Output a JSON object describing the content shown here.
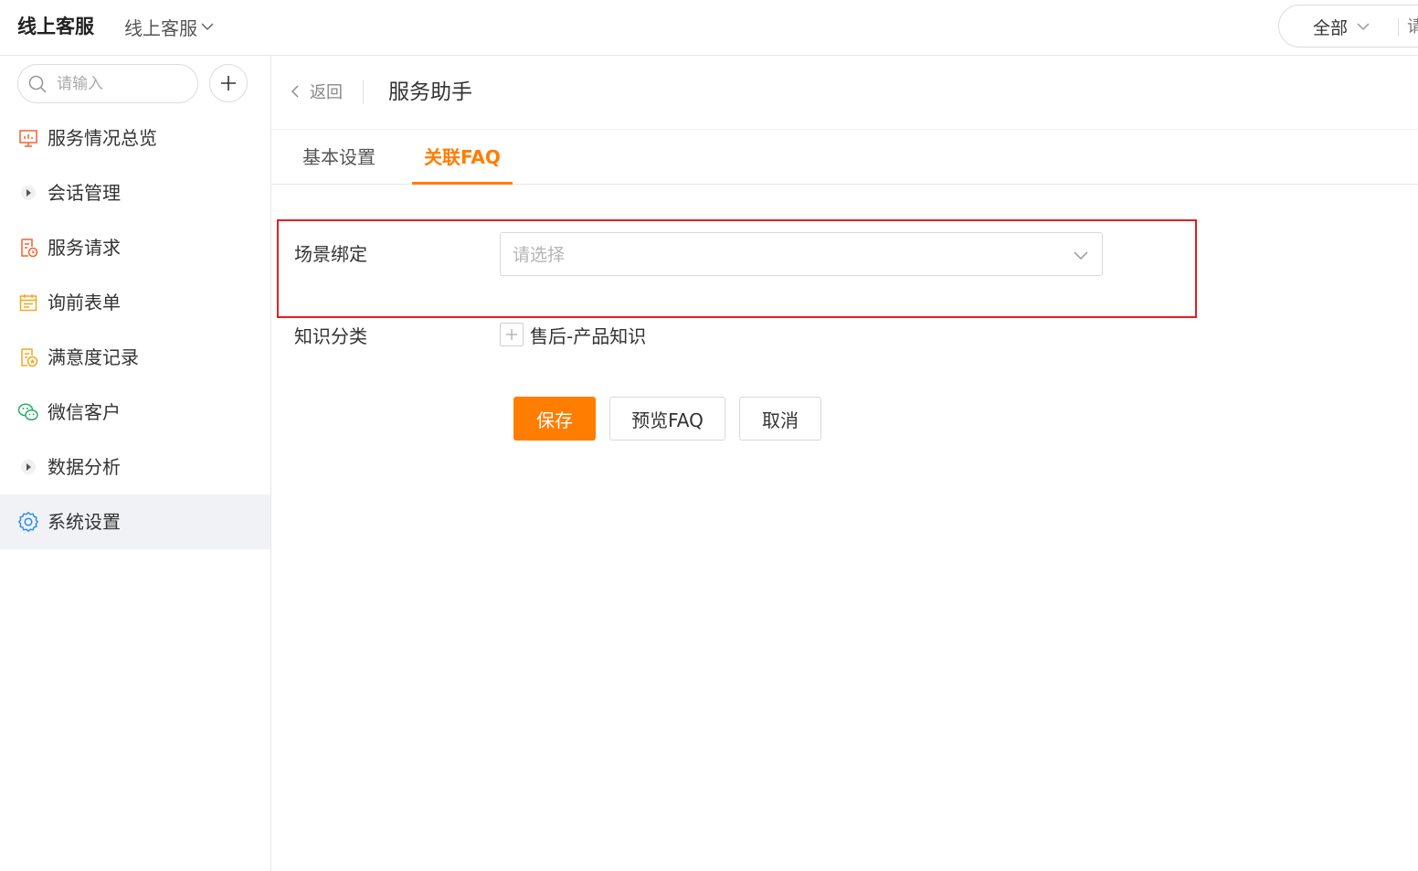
{
  "topbar": {
    "brand": "线上客服",
    "app_switch_label": "线上客服",
    "scope_label": "全部",
    "scope_search_placeholder": "请"
  },
  "sidebar": {
    "search_placeholder": "请输入",
    "items": [
      {
        "label": "服务情况总览",
        "icon": "dashboard-chart-icon",
        "color": "#f5602e"
      },
      {
        "label": "会话管理",
        "icon": "caret-right-icon",
        "color": "#6b7280"
      },
      {
        "label": "服务请求",
        "icon": "service-request-icon",
        "color": "#f5602e"
      },
      {
        "label": "询前表单",
        "icon": "calendar-form-icon",
        "color": "#f5a623"
      },
      {
        "label": "满意度记录",
        "icon": "satisfaction-record-icon",
        "color": "#f5a623"
      },
      {
        "label": "微信客户",
        "icon": "wechat-icon",
        "color": "#2aae67"
      },
      {
        "label": "数据分析",
        "icon": "caret-right-icon",
        "color": "#6b7280"
      },
      {
        "label": "系统设置",
        "icon": "gear-icon",
        "color": "#2d8cf0",
        "active": true
      }
    ]
  },
  "header": {
    "back_label": "返回",
    "title": "服务助手"
  },
  "tabs": [
    {
      "label": "基本设置",
      "active": false
    },
    {
      "label": "关联FAQ",
      "active": true
    }
  ],
  "form": {
    "scene_label": "场景绑定",
    "scene_placeholder": "请选择",
    "category_label": "知识分类",
    "category_node": "售后-产品知识"
  },
  "actions": {
    "save": "保存",
    "preview": "预览FAQ",
    "cancel": "取消"
  },
  "colors": {
    "accent": "#ff7d00",
    "highlight_border": "#e02020",
    "active_menu_bg": "#f1f2f5"
  }
}
